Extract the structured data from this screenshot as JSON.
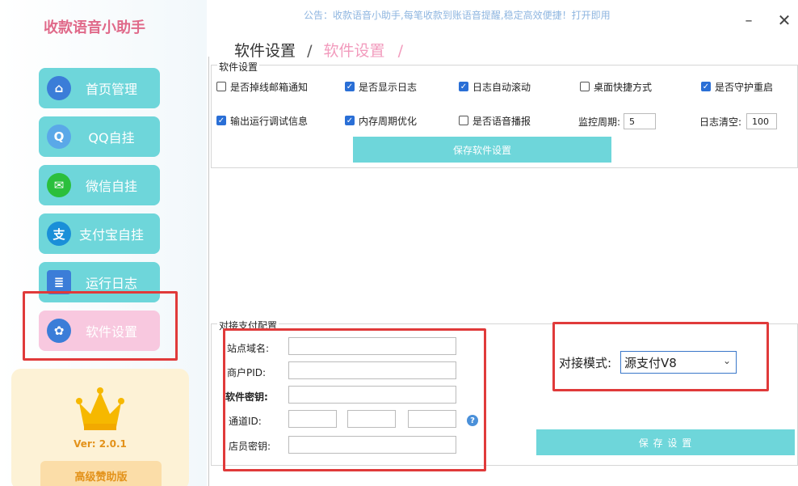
{
  "app": {
    "title": "收款语音小助手",
    "notice": "公告：收款语音小助手,每笔收款到账语音提醒,稳定高效便捷！打开即用",
    "minimize_icon": "minimize-icon",
    "close_icon": "close-icon",
    "min_glyph": "–",
    "close_glyph": "✕"
  },
  "sidebar": {
    "items": [
      {
        "label": "首页管理",
        "icon": "home-icon",
        "glyph": "⌂",
        "icon_color": "#3b7dd8"
      },
      {
        "label": "QQ自挂",
        "icon": "qq-icon",
        "glyph": "Q",
        "icon_color": "#5aa8e8"
      },
      {
        "label": "微信自挂",
        "icon": "wechat-icon",
        "glyph": "✉",
        "icon_color": "#2bbf3c"
      },
      {
        "label": "支付宝自挂",
        "icon": "alipay-icon",
        "glyph": "支",
        "icon_color": "#1a8fd8"
      },
      {
        "label": "运行日志",
        "icon": "clipboard-icon",
        "glyph": "≣",
        "icon_color": "#3b7dd8"
      },
      {
        "label": "软件设置",
        "icon": "gear-icon",
        "glyph": "✿",
        "icon_color": "#3b7dd8",
        "active": true
      }
    ],
    "version": "Ver:  2.0.1",
    "promo_button": "高级赞助版"
  },
  "breadcrumb": {
    "parent": "软件设置",
    "current": "软件设置",
    "separator": "/"
  },
  "software_settings": {
    "group_title": "软件设置",
    "row1": [
      {
        "label": "是否掉线邮箱通知",
        "checked": false
      },
      {
        "label": "是否显示日志",
        "checked": true
      },
      {
        "label": "日志自动滚动",
        "checked": true
      },
      {
        "label": "桌面快捷方式",
        "checked": false
      },
      {
        "label": "是否守护重启",
        "checked": true
      }
    ],
    "row2": [
      {
        "label": "输出运行调试信息",
        "checked": true
      },
      {
        "label": "内存周期优化",
        "checked": true
      },
      {
        "label": "是否语音播报",
        "checked": false
      }
    ],
    "monitor_label": "监控周期:",
    "monitor_value": "5",
    "log_clear_label": "日志清空:",
    "log_clear_value": "100",
    "save_button": "保存软件设置"
  },
  "payment_config": {
    "group_title": "对接支付配置",
    "site_domain_label": "站点域名:",
    "merchant_pid_label": "商户PID:",
    "software_key_label": "软件密钥:",
    "channel_id_label": "通道ID:",
    "clerk_key_label": "店员密钥:",
    "mode_label": "对接模式:",
    "mode_value": "源支付V8",
    "save_button": "保 存 设 置"
  }
}
